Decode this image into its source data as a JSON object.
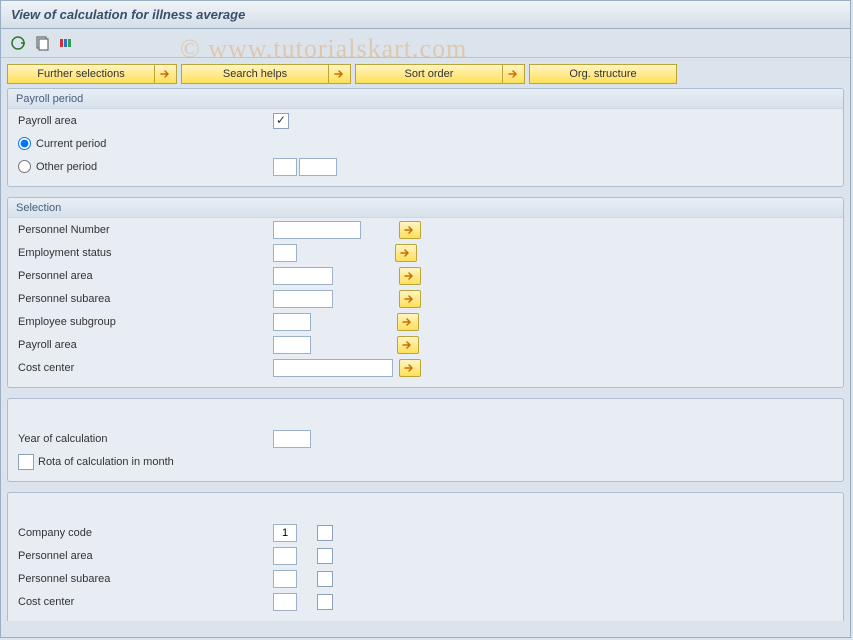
{
  "title": "View of calculation for illness average",
  "watermark": "© www.tutorialskart.com",
  "nav": {
    "further_selections": "Further selections",
    "search_helps": "Search helps",
    "sort_order": "Sort order",
    "org_structure": "Org. structure"
  },
  "payroll_period": {
    "header": "Payroll period",
    "payroll_area_label": "Payroll area",
    "current_period_label": "Current period",
    "other_period_label": "Other period"
  },
  "selection": {
    "header": "Selection",
    "fields": {
      "personnel_number": "Personnel Number",
      "employment_status": "Employment status",
      "personnel_area": "Personnel area",
      "personnel_subarea": "Personnel subarea",
      "employee_subgroup": "Employee subgroup",
      "payroll_area": "Payroll area",
      "cost_center": "Cost center"
    }
  },
  "calc": {
    "year_label": "Year of calculation",
    "rota_label": "Rota of calculation in month"
  },
  "org": {
    "company_code_label": "Company code",
    "company_code_value": "1",
    "personnel_area_label": "Personnel area",
    "personnel_subarea_label": "Personnel subarea",
    "cost_center_label": "Cost center"
  }
}
